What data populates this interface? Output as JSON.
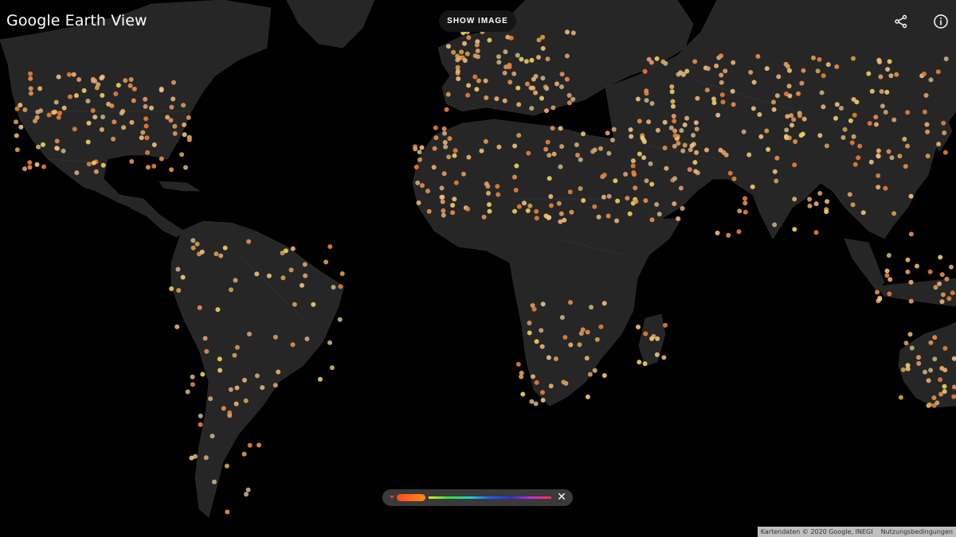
{
  "header": {
    "brand": "Google",
    "product": "Earth View",
    "show_image_label": "SHOW IMAGE"
  },
  "icons": {
    "share": "share-icon",
    "info": "info-icon",
    "close": "close-icon"
  },
  "legend": {
    "close_glyph": "✕",
    "selected_color": "#ff6a1a"
  },
  "attribution": {
    "map_data": "Kartendaten © 2020 Google, INEGI",
    "terms": "Nutzungsbedingungen"
  },
  "colors": {
    "background": "#000000",
    "land": "#262626",
    "dot_primary": "#f0a060"
  }
}
